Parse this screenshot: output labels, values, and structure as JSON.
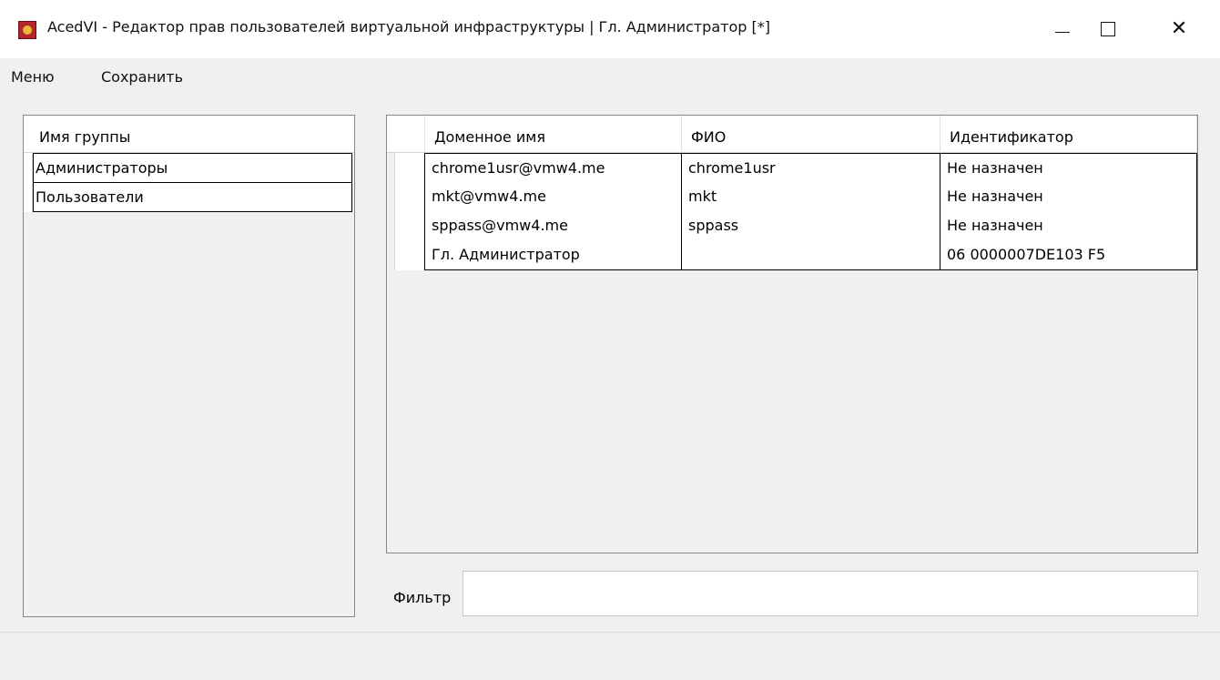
{
  "window": {
    "title": "AcedVI - Редактор прав пользователей виртуальной инфраструктуры | Гл. Администратор [*]",
    "controls": {
      "minimize": "—",
      "maximize": "☐",
      "close": "✕"
    }
  },
  "menu": {
    "items": [
      {
        "label": "Меню"
      },
      {
        "label": "Сохранить"
      }
    ]
  },
  "groups": {
    "header": "Имя группы",
    "rows": [
      {
        "name": "Администраторы"
      },
      {
        "name": "Пользователи"
      }
    ]
  },
  "users": {
    "columns": [
      "Доменное имя",
      "ФИО",
      "Идентификатор"
    ],
    "rows": [
      {
        "domain": "chrome1usr@vmw4.me",
        "fio": "chrome1usr",
        "id": "Не назначен"
      },
      {
        "domain": "mkt@vmw4.me",
        "fio": "mkt",
        "id": "Не назначен"
      },
      {
        "domain": "sppass@vmw4.me",
        "fio": "sppass",
        "id": "Не назначен"
      },
      {
        "domain": "Гл. Администратор",
        "fio": "",
        "id": "06 0000007DE103 F5"
      }
    ]
  },
  "filter": {
    "label": "Фильтр",
    "value": ""
  },
  "colors": {
    "chrome": "#f0f0f0",
    "grid_border": "#828790",
    "app_icon": "#b3262b"
  }
}
